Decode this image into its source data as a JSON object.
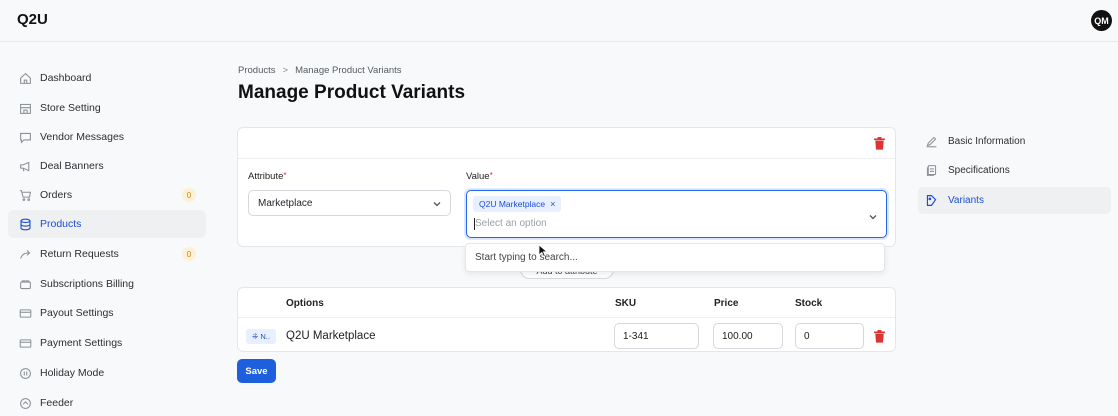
{
  "app": {
    "brand": "Q2U",
    "avatar_initials": "QM"
  },
  "sidebar": {
    "items": [
      {
        "label": "Dashboard",
        "icon": "home-icon"
      },
      {
        "label": "Store Setting",
        "icon": "store-icon"
      },
      {
        "label": "Vendor Messages",
        "icon": "message-icon"
      },
      {
        "label": "Deal Banners",
        "icon": "megaphone-icon"
      },
      {
        "label": "Orders",
        "icon": "cart-icon",
        "badge": "0"
      },
      {
        "label": "Products",
        "icon": "database-icon",
        "active": true
      },
      {
        "label": "Return Requests",
        "icon": "return-icon",
        "badge": "0"
      },
      {
        "label": "Subscriptions Billing",
        "icon": "billing-icon"
      },
      {
        "label": "Payout Settings",
        "icon": "card-icon"
      },
      {
        "label": "Payment Settings",
        "icon": "card-icon"
      },
      {
        "label": "Holiday Mode",
        "icon": "pause-icon"
      },
      {
        "label": "Feeder",
        "icon": "feeder-icon"
      }
    ]
  },
  "breadcrumb": {
    "root": "Products",
    "separator": ">",
    "current": "Manage Product Variants"
  },
  "page": {
    "title": "Manage Product Variants"
  },
  "attribute_card": {
    "attribute_label": "Attribute",
    "value_label": "Value",
    "required_mark": "*",
    "attribute_value": "Marketplace",
    "selected_tag": "Q2U Marketplace",
    "tag_remove": "×",
    "value_placeholder": "Select an option",
    "dropdown_hint": "Start typing to search...",
    "add_button": "Add to attribute"
  },
  "variants_table": {
    "headers": {
      "options": "Options",
      "sku": "SKU",
      "price": "Price",
      "stock": "Stock"
    },
    "rows": [
      {
        "chip": "⁜ N..",
        "option": "Q2U Marketplace",
        "sku": "1-341",
        "price": "100.00",
        "stock": "0"
      }
    ]
  },
  "save_label": "Save",
  "right_nav": {
    "items": [
      {
        "label": "Basic Information",
        "icon": "edit-icon"
      },
      {
        "label": "Specifications",
        "icon": "copy-icon"
      },
      {
        "label": "Variants",
        "icon": "layers-icon",
        "active": true
      }
    ]
  },
  "colors": {
    "accent": "#1d5fdd",
    "danger": "#dd3333",
    "badge": "#c58a14"
  }
}
